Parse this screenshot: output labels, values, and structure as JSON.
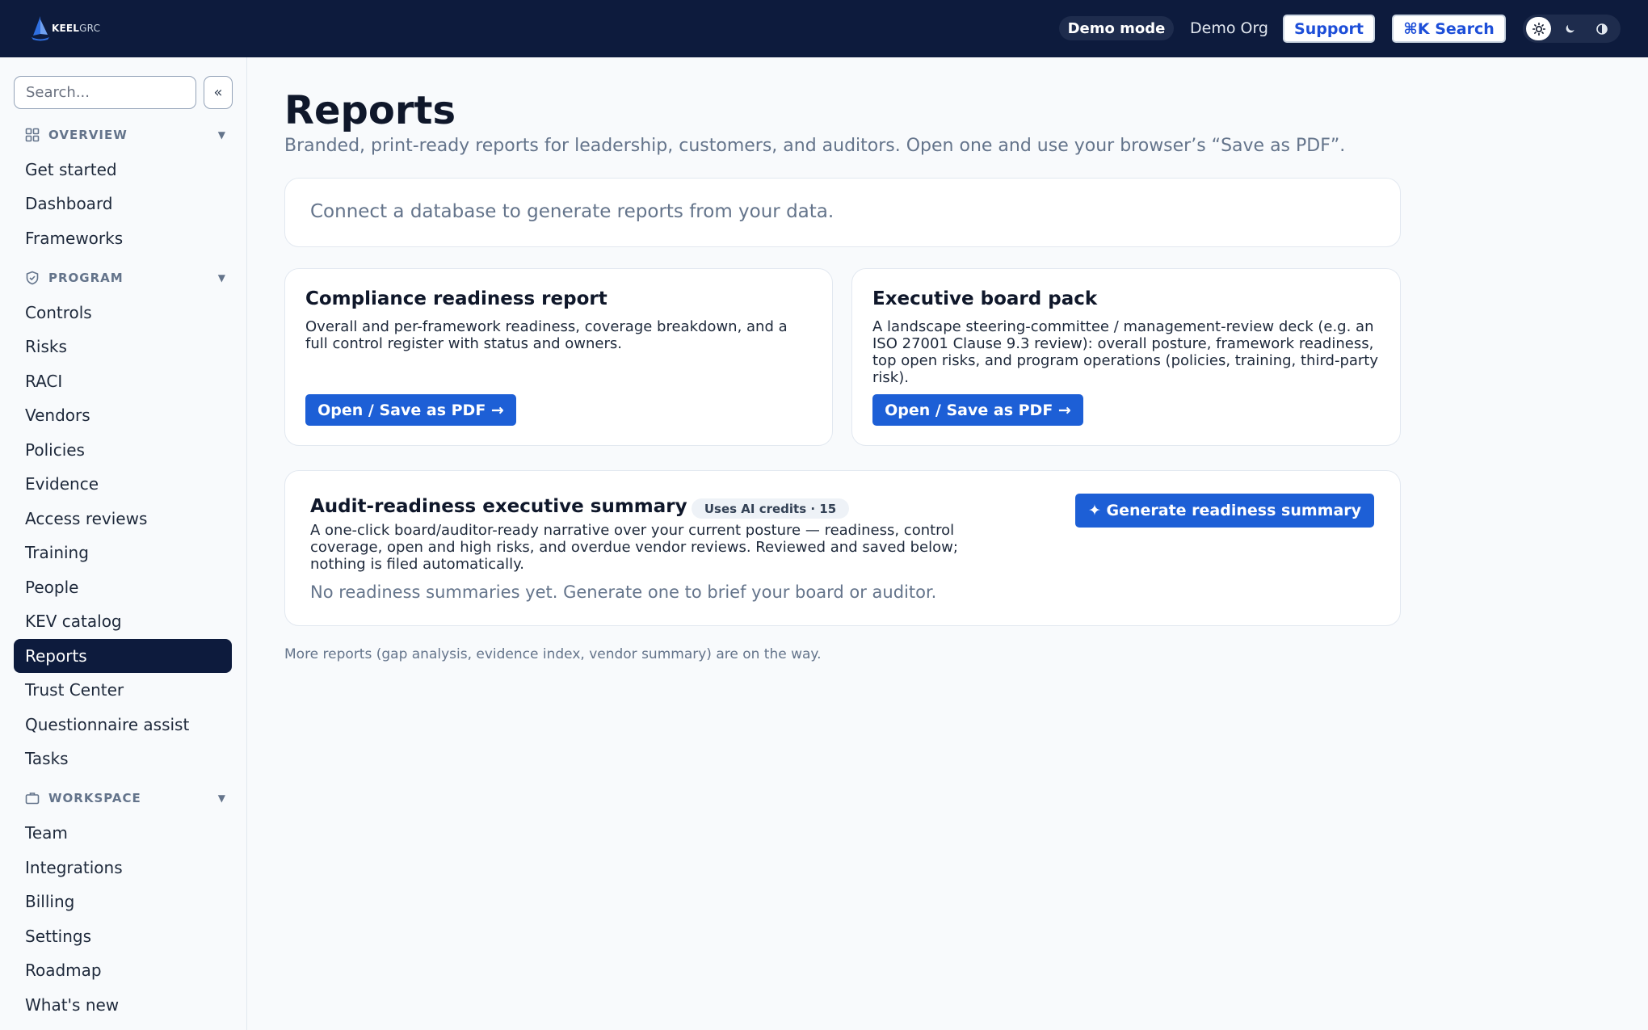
{
  "topbar": {
    "logo_text_bold": "KEEL",
    "logo_text_light": "GRC",
    "demo_mode": "Demo mode",
    "org_name": "Demo Org",
    "support_label": "Support",
    "search_label": "⌘K Search",
    "theme_options": [
      "sun-icon",
      "moon-icon",
      "contrast-icon"
    ],
    "brand_color": "#0d1b3d"
  },
  "sidebar": {
    "search_placeholder": "Search...",
    "collapse_label": "«",
    "sections": [
      {
        "title": "OVERVIEW",
        "icon": "grid-icon",
        "items": [
          "Get started",
          "Dashboard",
          "Frameworks"
        ]
      },
      {
        "title": "PROGRAM",
        "icon": "shield-icon",
        "items": [
          "Controls",
          "Risks",
          "RACI",
          "Vendors",
          "Policies",
          "Evidence",
          "Access reviews",
          "Training",
          "People",
          "KEV catalog",
          "Reports",
          "Trust Center",
          "Questionnaire assist",
          "Tasks"
        ]
      },
      {
        "title": "WORKSPACE",
        "icon": "briefcase-icon",
        "items": [
          "Team",
          "Integrations",
          "Billing",
          "Settings",
          "Roadmap",
          "What's new"
        ]
      }
    ],
    "active_item": "Reports"
  },
  "main": {
    "title": "Reports",
    "subtitle": "Branded, print-ready reports for leadership, customers, and auditors. Open one and use your browser’s “Save as PDF”.",
    "notice": "Connect a database to generate reports from your data.",
    "reports": [
      {
        "title": "Compliance readiness report",
        "description": "Overall and per-framework readiness, coverage breakdown, and a full control register with status and owners.",
        "button": "Open / Save as PDF →"
      },
      {
        "title": "Executive board pack",
        "description": "A landscape steering-committee / management-review deck (e.g. an ISO 27001 Clause 9.3 review): overall posture, framework readiness, top open risks, and program operations (policies, training, third-party risk).",
        "button": "Open / Save as PDF →"
      }
    ],
    "summary": {
      "title": "Audit-readiness executive summary",
      "badge": "Uses AI credits · 15",
      "description": "A one-click board/auditor-ready narrative over your current posture — readiness, control coverage, open and high risks, and overdue vendor reviews. Reviewed and saved below; nothing is filed automatically.",
      "empty_state": "No readiness summaries yet. Generate one to brief your board or auditor.",
      "button": "✦ Generate readiness summary"
    },
    "footnote": "More reports (gap analysis, evidence index, vendor summary) are on the way.",
    "accent_color": "#1d5fd6"
  }
}
